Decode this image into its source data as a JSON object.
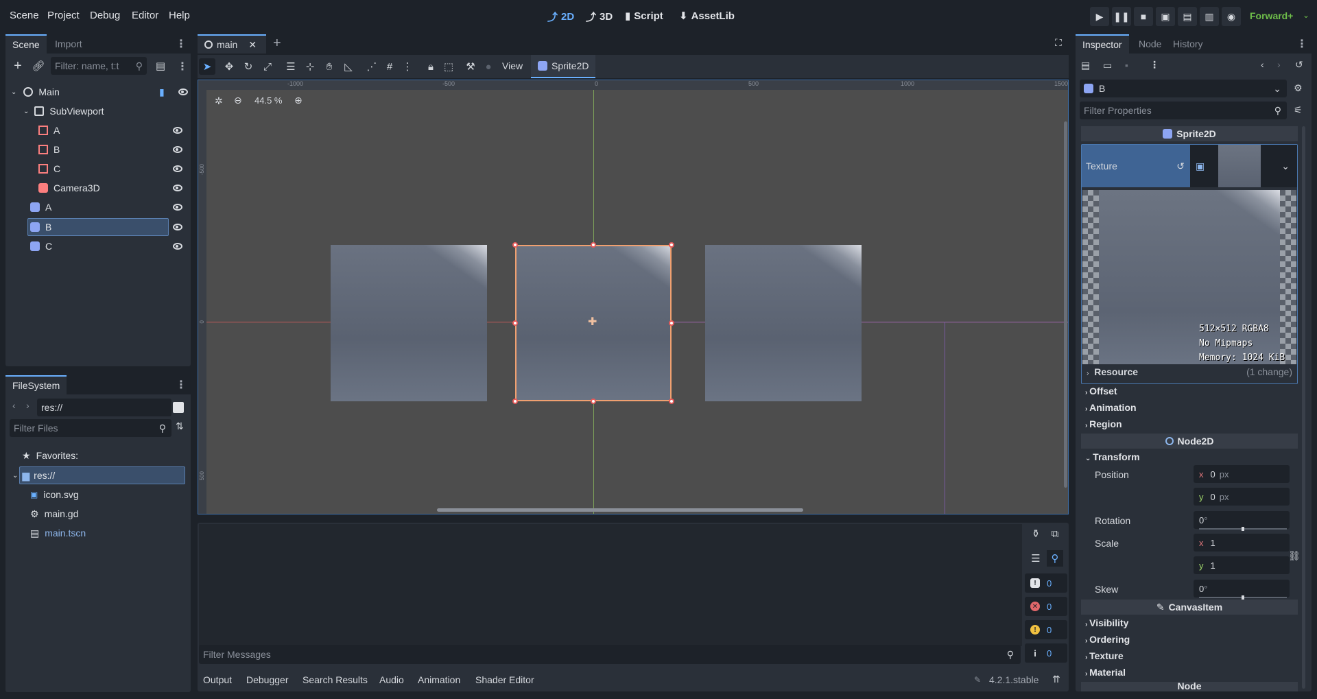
{
  "menu": [
    "Scene",
    "Project",
    "Debug",
    "Editor",
    "Help"
  ],
  "workspaces": [
    {
      "label": "2D",
      "icon": "2d-icon"
    },
    {
      "label": "3D",
      "icon": "3d-icon"
    },
    {
      "label": "Script",
      "icon": "script-icon"
    },
    {
      "label": "AssetLib",
      "icon": "assetlib-icon"
    }
  ],
  "renderer": "Forward+",
  "scene_dock": {
    "tabs": [
      "Scene",
      "Import"
    ],
    "filter_placeholder": "Filter: name, t:t",
    "tree": [
      {
        "label": "Main",
        "icon": "node2d-icon",
        "depth": 0
      },
      {
        "label": "SubViewport",
        "icon": "subviewport-icon",
        "depth": 1
      },
      {
        "label": "A",
        "icon": "mesh-icon",
        "depth": 2
      },
      {
        "label": "B",
        "icon": "mesh-icon",
        "depth": 2
      },
      {
        "label": "C",
        "icon": "mesh-icon",
        "depth": 2
      },
      {
        "label": "Camera3D",
        "icon": "camera3d-icon",
        "depth": 2
      },
      {
        "label": "A",
        "icon": "sprite2d-icon",
        "depth": 1
      },
      {
        "label": "B",
        "icon": "sprite2d-icon",
        "depth": 1,
        "selected": true
      },
      {
        "label": "C",
        "icon": "sprite2d-icon",
        "depth": 1
      }
    ]
  },
  "filesystem_dock": {
    "tab": "FileSystem",
    "path": "res://",
    "filter_placeholder": "Filter Files",
    "favorites": "Favorites:",
    "root": "res://",
    "files": [
      {
        "label": "icon.svg",
        "icon": "svg-file-icon"
      },
      {
        "label": "main.gd",
        "icon": "gear-icon"
      },
      {
        "label": "main.tscn",
        "icon": "scene-file-icon"
      }
    ]
  },
  "editor": {
    "tab": "main",
    "toolbar_view": "View",
    "toolbar_node": "Sprite2D",
    "zoom": "44.5 %",
    "ruler_h": [
      "-1000",
      "-500",
      "0",
      "500",
      "1000",
      "1500"
    ],
    "ruler_v": [
      "-500",
      "0",
      "500"
    ]
  },
  "output": {
    "filter_placeholder": "Filter Messages",
    "counts": [
      "0",
      "0",
      "0",
      "0"
    ],
    "tabs": [
      "Output",
      "Debugger",
      "Search Results",
      "Audio",
      "Animation",
      "Shader Editor"
    ],
    "version": "4.2.1.stable"
  },
  "inspector": {
    "tabs": [
      "Inspector",
      "Node",
      "History"
    ],
    "object": "B",
    "filter_placeholder": "Filter Properties",
    "sprite_section": "Sprite2D",
    "texture_label": "Texture",
    "texture_info": [
      "512×512 RGBA8",
      "No Mipmaps",
      "Memory: 1024 KiB"
    ],
    "resource_label": "Resource",
    "resource_change": "(1 change)",
    "sprite_groups": [
      "Offset",
      "Animation",
      "Region"
    ],
    "node2d_section": "Node2D",
    "transform_label": "Transform",
    "position_label": "Position",
    "position_x": "0",
    "position_y": "0",
    "px": "px",
    "rotation_label": "Rotation",
    "rotation_value": "0",
    "scale_label": "Scale",
    "scale_x": "1",
    "scale_y": "1",
    "skew_label": "Skew",
    "skew_value": "0",
    "degree": "°",
    "canvasitem_section": "CanvasItem",
    "canvas_groups": [
      "Visibility",
      "Ordering",
      "Texture",
      "Material"
    ],
    "node_section": "Node"
  }
}
